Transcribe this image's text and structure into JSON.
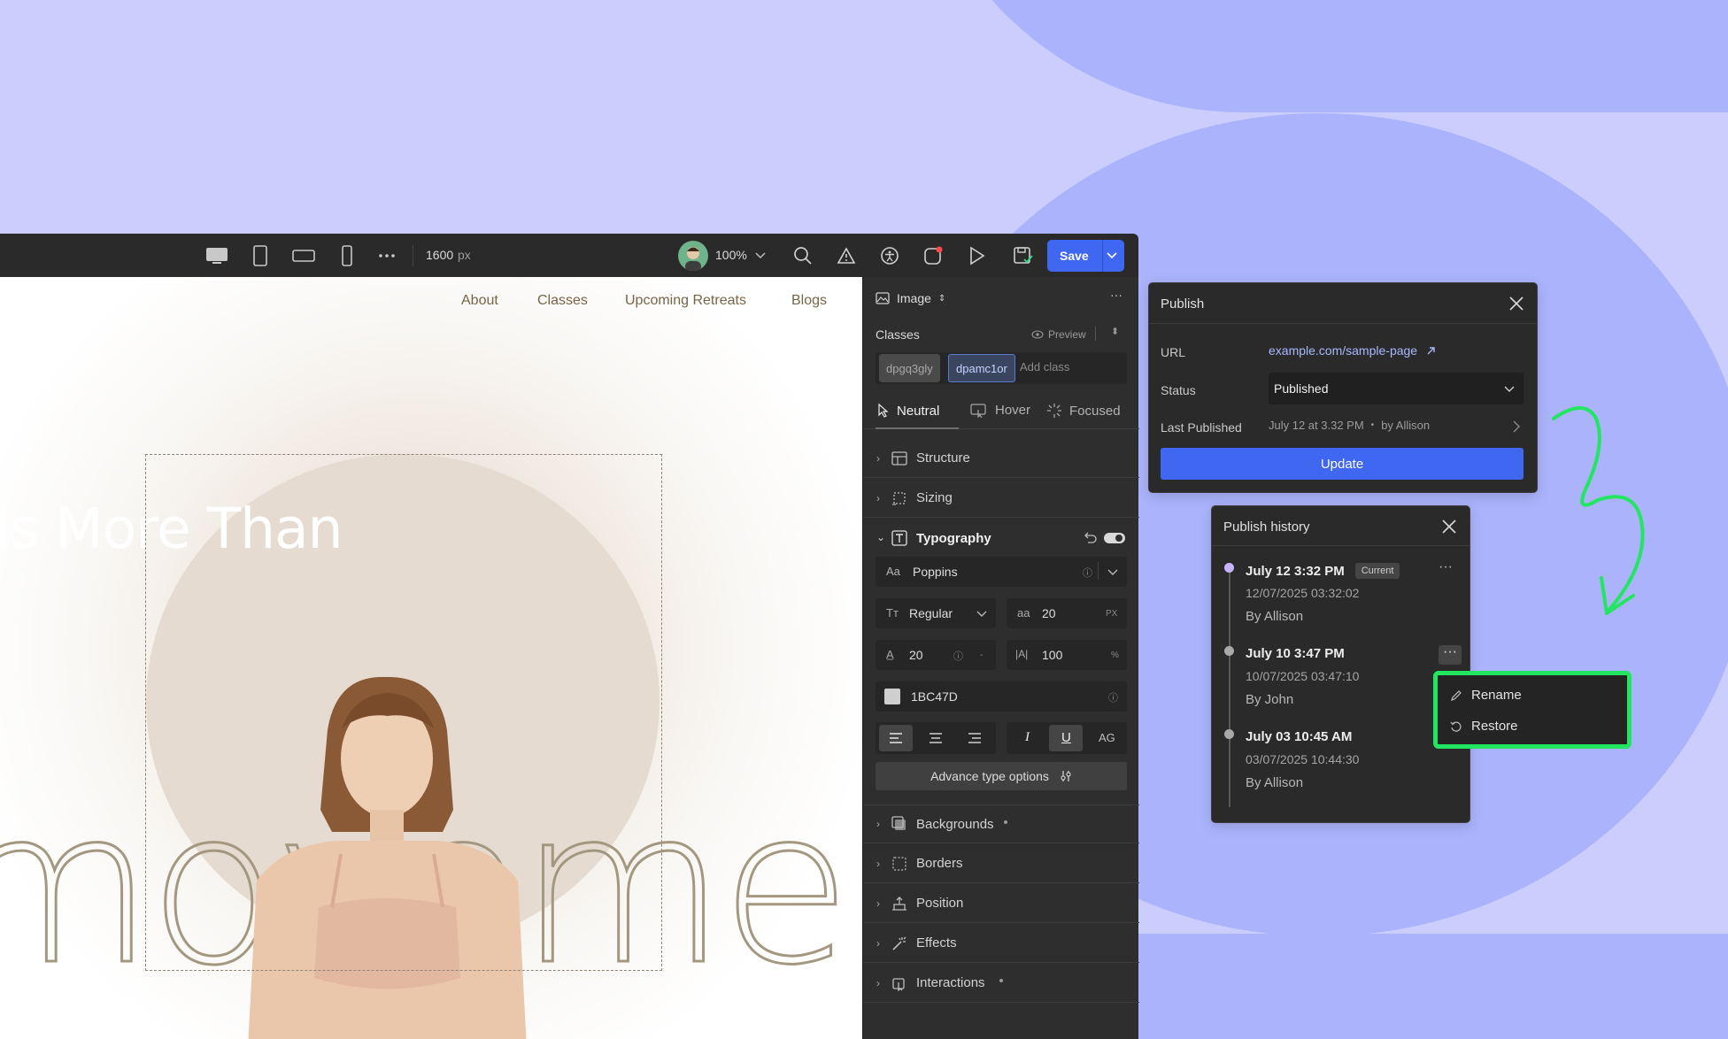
{
  "toolbar": {
    "width_value": "1600",
    "width_unit": "px",
    "zoom": "100%",
    "save_label": "Save",
    "devices": [
      "desktop-icon",
      "tablet-icon",
      "tablet-landscape-icon",
      "mobile-icon",
      "more-icon"
    ]
  },
  "canvas": {
    "nav": [
      "About",
      "Classes",
      "Upcoming Retreats",
      "Blogs"
    ],
    "hero_title": "Is More Than",
    "hero_word": "movemen"
  },
  "panel": {
    "element_type": "Image",
    "classes_label": "Classes",
    "preview_label": "Preview",
    "class_chips": [
      "dpgq3gly",
      "dpamc1or"
    ],
    "add_class_placeholder": "Add class",
    "states": [
      "Neutral",
      "Hover",
      "Focused"
    ],
    "sections_top": [
      "Structure",
      "Sizing"
    ],
    "typography_label": "Typography",
    "font_family": "Poppins",
    "font_weight": "Regular",
    "font_size": "20",
    "font_size_unit": "PX",
    "line_height": "20",
    "line_height_unit": "-",
    "letter_spacing": "100",
    "letter_spacing_unit": "%",
    "color_hex": "1BC47D",
    "style_options": [
      "I",
      "U",
      "AG"
    ],
    "advance_label": "Advance type options",
    "sections_bottom": [
      "Backgrounds",
      "Borders",
      "Position",
      "Effects",
      "Interactions"
    ]
  },
  "publish": {
    "title": "Publish",
    "url_label": "URL",
    "url_value": "example.com/sample-page",
    "status_label": "Status",
    "status_value": "Published",
    "last_label": "Last Published",
    "last_value": "July 12 at 3.32 PM",
    "last_by": "by Allison",
    "update_label": "Update"
  },
  "history": {
    "title": "Publish history",
    "current_badge": "Current",
    "items": [
      {
        "title": "July 12 3:32 PM",
        "stamp": "12/07/2025 03:32:02",
        "by": "By Allison"
      },
      {
        "title": "July 10 3:47 PM",
        "stamp": "10/07/2025 03:47:10",
        "by": "By John"
      },
      {
        "title": "July 03 10:45 AM",
        "stamp": "03/07/2025 10:44:30",
        "by": "By Allison"
      }
    ]
  },
  "context_menu": {
    "rename": "Rename",
    "restore": "Restore"
  },
  "colors": {
    "accent": "#3f67f2",
    "highlight": "#22e65f",
    "background": "#cbcefd",
    "background_shape": "#aab3fc",
    "swatch": "#cfcfcf"
  }
}
